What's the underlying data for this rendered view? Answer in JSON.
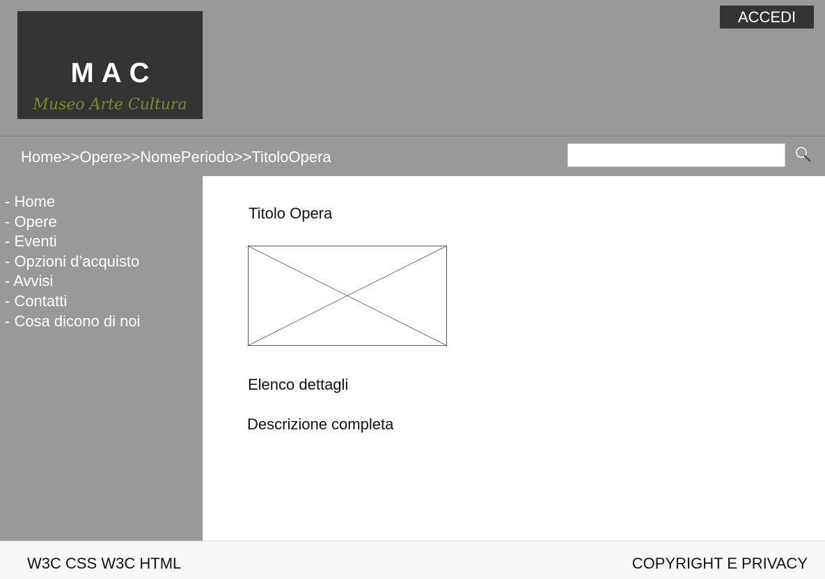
{
  "header": {
    "logo_title": "MAC",
    "logo_subtitle": "Museo Arte Cultura",
    "login_label": "ACCEDI"
  },
  "nav": {
    "breadcrumb": "Home>>Opere>>NomePeriodo>>TitoloOpera",
    "search_value": "",
    "search_icon": "search-icon"
  },
  "sidebar": {
    "items": [
      {
        "label": "- Home"
      },
      {
        "label": "- Opere"
      },
      {
        "label": "- Eventi"
      },
      {
        "label": "- Opzioni d’acquisto"
      },
      {
        "label": "- Avvisi"
      },
      {
        "label": "- Contatti"
      },
      {
        "label": "- Cosa dicono di noi"
      }
    ]
  },
  "main": {
    "title": "Titolo Opera",
    "details_heading": "Elenco dettagli",
    "description_heading": "Descrizione completa"
  },
  "footer": {
    "w3c_css": "W3C CSS",
    "w3c_html": "W3C HTML",
    "copyright": "COPYRIGHT E PRIVACY"
  },
  "colors": {
    "background": "#999999",
    "logo_background": "#333333",
    "logo_subtitle": "#7a8c2e",
    "content_background": "#ffffff",
    "footer_background": "#f9f8f6"
  }
}
